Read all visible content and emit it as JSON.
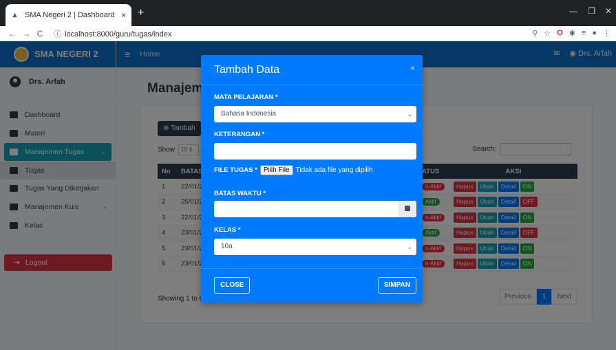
{
  "browser": {
    "tab_title": "SMA Negeri 2 | Dashboard",
    "tab_close": "×",
    "new_tab": "+",
    "url": "localhost:8000/guru/tugas/index",
    "back": "←",
    "forward": "→",
    "reload": "C"
  },
  "app": {
    "brand": "SMA NEGERI 2",
    "user": "Drs. Arfah",
    "nav_home": "Home",
    "nav_user": "Drs. Arfah"
  },
  "sidebar": {
    "items": [
      {
        "label": "Dashboard"
      },
      {
        "label": "Materi"
      },
      {
        "label": "Manajemen Tugas"
      },
      {
        "label": "Tugas"
      },
      {
        "label": "Tugas Yang Dikerjakan"
      },
      {
        "label": "Manajemen Kuis"
      },
      {
        "label": "Kelas"
      }
    ],
    "logout": "Logout"
  },
  "main": {
    "title": "Manajeme",
    "add_button": "Tambah",
    "show_label": "Show",
    "show_value": "10",
    "entries_label": "er",
    "search_label": "Search:",
    "columns": [
      "No",
      "BATAS",
      "ATUS",
      "AKSI"
    ],
    "rows": [
      {
        "no": "1",
        "batas": "22/01/2",
        "status": "n-Aktif"
      },
      {
        "no": "2",
        "batas": "25/01/2",
        "status": "Aktif"
      },
      {
        "no": "3",
        "batas": "22/01/2",
        "status": "n-Aktif"
      },
      {
        "no": "4",
        "batas": "23/01/2",
        "status": "Aktif"
      },
      {
        "no": "5",
        "batas": "23/01/2",
        "status": "n-Aktif"
      },
      {
        "no": "6",
        "batas": "23/01/2",
        "status": "n-Aktif"
      }
    ],
    "action_delete": "Hapus",
    "action_edit": "Ubah",
    "action_detail": "Detail",
    "toggles": [
      "ON",
      "OFF",
      "ON",
      "OFF",
      "ON",
      "ON"
    ],
    "showing": "Showing 1 to 6 of",
    "pager_prev": "Previous",
    "pager_current": "1",
    "pager_next": "Next"
  },
  "modal": {
    "title": "Tambah Data",
    "close_x": "×",
    "mapel_label": "MATA PELAJARAN *",
    "mapel_value": "Bahasa Indonesia",
    "keterangan_label": "KETERANGAN *",
    "file_label": "FILE TUGAS *",
    "file_button": "Pilih File",
    "file_status": "Tidak ada file yang dipilih",
    "batas_label": "BATAS WAKTU *",
    "kelas_label": "KELAS *",
    "kelas_value": "10a",
    "close_button": "CLOSE",
    "save_button": "SIMPAN"
  }
}
